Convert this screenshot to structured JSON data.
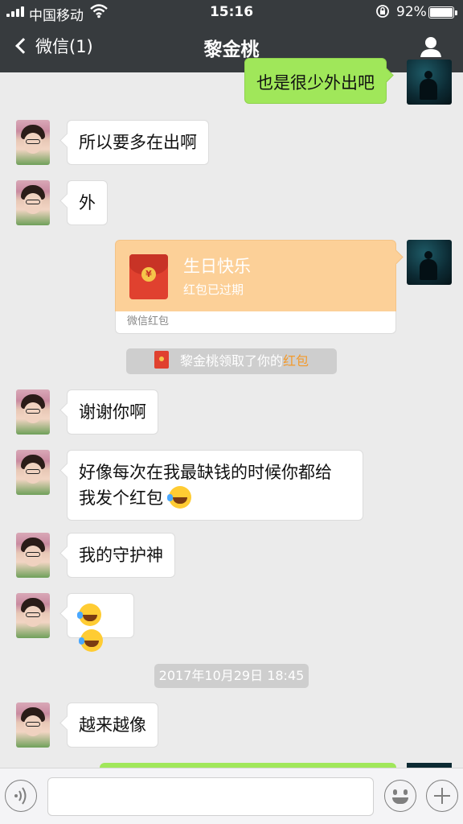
{
  "status_bar": {
    "carrier": "中国移动",
    "time": "15:16",
    "battery_percent": "92%",
    "battery_level": 0.92,
    "signal_icon": "signal-bars-icon",
    "wifi_icon": "wifi-icon",
    "lock_icon": "rotation-lock-icon"
  },
  "nav": {
    "back_label": "微信(1)",
    "title": "黎金桃",
    "profile_icon": "person-icon"
  },
  "messages": [
    {
      "from": "me",
      "text": "也是很少外出吧"
    },
    {
      "from": "her",
      "text": "所以要多在出啊"
    },
    {
      "from": "her",
      "text": "外"
    },
    {
      "from": "me",
      "type": "red_packet",
      "title": "生日快乐",
      "subtitle": "红包已过期",
      "footer": "微信红包"
    },
    {
      "type": "system",
      "prefix": "黎金桃领取了你的",
      "highlight": "红包"
    },
    {
      "from": "her",
      "text": "谢谢你啊"
    },
    {
      "from": "her",
      "text_line1": "好像每次在我最缺钱的时候你都给",
      "text_line2": "我发个红包"
    },
    {
      "from": "her",
      "text": "我的守护神"
    },
    {
      "from": "her",
      "type": "emoji",
      "emoji": "laugh-cry-emoji"
    },
    {
      "type": "timestamp",
      "text": "2017年10月29日 18:45"
    },
    {
      "from": "her",
      "text": "越来越像"
    }
  ],
  "colors": {
    "nav_bg": "#373b3e",
    "chat_bg": "#ebebeb",
    "my_bubble": "#a0e75a",
    "red_packet": "#fcd098",
    "highlight": "#f39a2c"
  },
  "input_bar": {
    "voice_icon": "voice-icon",
    "emoji_icon": "smiley-icon",
    "plus_icon": "plus-icon",
    "placeholder": ""
  }
}
